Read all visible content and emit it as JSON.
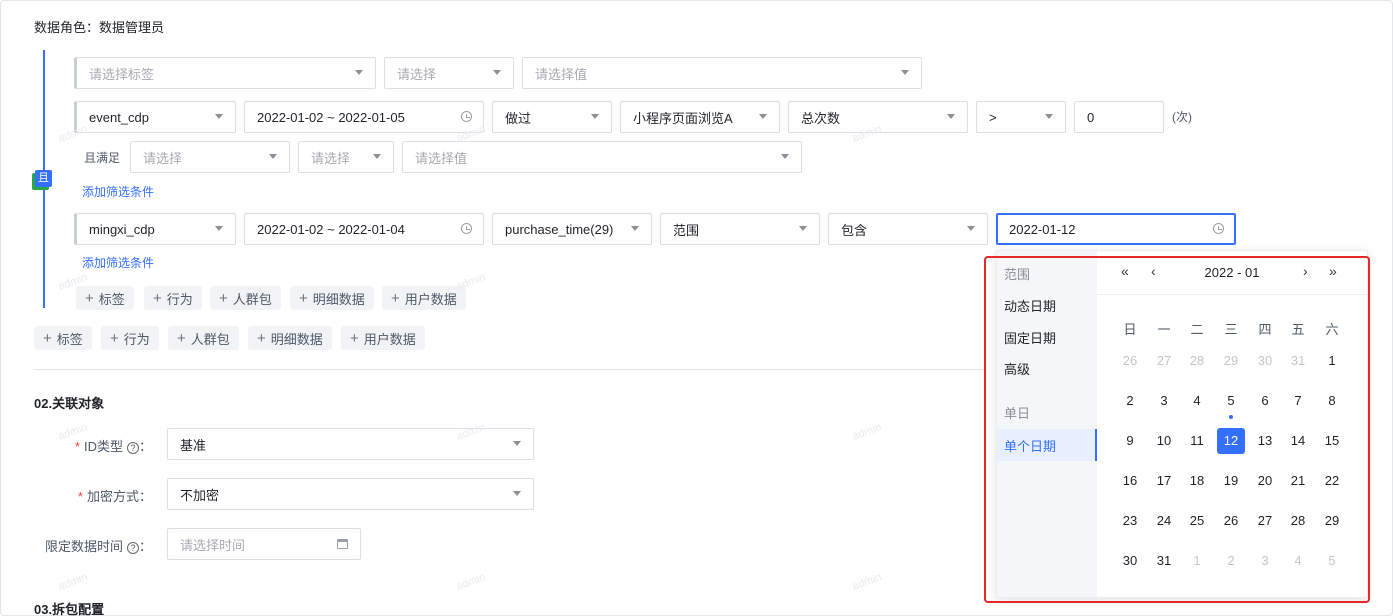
{
  "header": {
    "role_text": "数据角色：数据管理员"
  },
  "rule_row1": {
    "tag_placeholder": "请选择标签",
    "op_placeholder": "请选择",
    "value_placeholder": "请选择值"
  },
  "event_row": {
    "event": "event_cdp",
    "date_range": "2022-01-02 ~ 2022-01-05",
    "did": "做过",
    "page": "小程序页面浏览A",
    "metric": "总次数",
    "compare": ">",
    "count": "0",
    "unit": "(次)"
  },
  "sub_filter": {
    "label": "且满足",
    "field_placeholder": "请选择",
    "op_placeholder": "请选择",
    "value_placeholder": "请选择值",
    "add_link": "添加筛选条件"
  },
  "and_badge": "且",
  "detail_row": {
    "table": "mingxi_cdp",
    "date_range": "2022-01-02 ~ 2022-01-04",
    "field": "purchase_time(29)",
    "mode": "范围",
    "op": "包含",
    "date": "2022-01-12",
    "add_link": "添加筛选条件"
  },
  "inner_chips": [
    "标签",
    "行为",
    "人群包",
    "明细数据",
    "用户数据"
  ],
  "outer_chips": [
    "标签",
    "行为",
    "人群包",
    "明细数据",
    "用户数据"
  ],
  "section2": {
    "title": "02.关联对象",
    "id_type_label": "ID类型",
    "id_type_value": "基准",
    "encrypt_label": "加密方式",
    "encrypt_value": "不加密",
    "limit_label": "限定数据时间",
    "limit_placeholder": "请选择时间"
  },
  "section3": {
    "title": "03.拆包配置"
  },
  "watermark": "admin",
  "popup": {
    "group1": "范围",
    "item_dynamic": "动态日期",
    "item_fixed": "固定日期",
    "item_advanced": "高级",
    "group2": "单日",
    "item_single": "单个日期",
    "nav_prev_year": "«",
    "nav_prev_month": "‹",
    "nav_next_month": "›",
    "nav_next_year": "»",
    "month_title": "2022 - 01",
    "weekdays": [
      "日",
      "一",
      "二",
      "三",
      "四",
      "五",
      "六"
    ],
    "weeks": [
      [
        "26",
        "27",
        "28",
        "29",
        "30",
        "31",
        "1"
      ],
      [
        "2",
        "3",
        "4",
        "5",
        "6",
        "7",
        "8"
      ],
      [
        "9",
        "10",
        "11",
        "12",
        "13",
        "14",
        "15"
      ],
      [
        "16",
        "17",
        "18",
        "19",
        "20",
        "21",
        "22"
      ],
      [
        "23",
        "24",
        "25",
        "26",
        "27",
        "28",
        "29"
      ],
      [
        "30",
        "31",
        "1",
        "2",
        "3",
        "4",
        "5"
      ]
    ],
    "selected_day": "12",
    "today_marker_day": "5"
  }
}
